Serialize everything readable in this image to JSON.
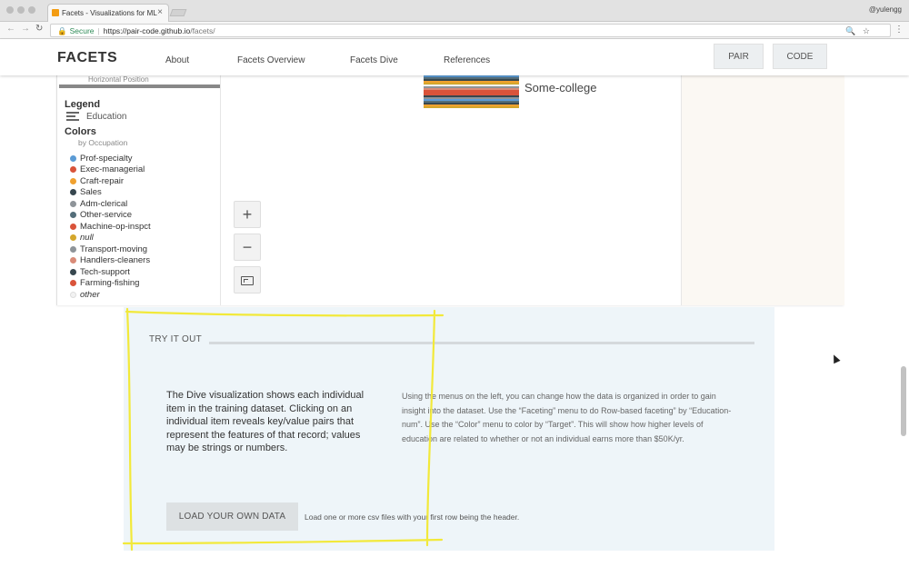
{
  "browser": {
    "tab_title": "Facets - Visualizations for ML",
    "profile": "@yulengg",
    "secure_label": "Secure",
    "url_main": "https://pair-code.github.io",
    "url_path": "/facets/"
  },
  "header": {
    "brand": "FACETS",
    "nav": [
      "About",
      "Facets Overview",
      "Facets Dive",
      "References"
    ],
    "buttons": [
      "PAIR",
      "CODE"
    ]
  },
  "dive": {
    "hidden_control_label": "Horizontal Position",
    "legend_title": "Legend",
    "legend_sub": "Education",
    "colors_title": "Colors",
    "colors_sub": "by Occupation",
    "colors": [
      {
        "label": "Prof-specialty",
        "color": "#5b9bd5",
        "italic": false
      },
      {
        "label": "Exec-managerial",
        "color": "#d9533a",
        "italic": false
      },
      {
        "label": "Craft-repair",
        "color": "#f0a12f",
        "italic": false
      },
      {
        "label": "Sales",
        "color": "#37474f",
        "italic": false
      },
      {
        "label": "Adm-clerical",
        "color": "#8e9499",
        "italic": false
      },
      {
        "label": "Other-service",
        "color": "#546e7a",
        "italic": false
      },
      {
        "label": "Machine-op-inspct",
        "color": "#d9533a",
        "italic": false
      },
      {
        "label": "null",
        "color": "#d4a72c",
        "italic": true
      },
      {
        "label": "Transport-moving",
        "color": "#8e9499",
        "italic": false
      },
      {
        "label": "Handlers-cleaners",
        "color": "#d98b78",
        "italic": false
      },
      {
        "label": "Tech-support",
        "color": "#37474f",
        "italic": false
      },
      {
        "label": "Farming-fishing",
        "color": "#d9533a",
        "italic": false
      },
      {
        "label": "other",
        "color": "#f2f2f2",
        "italic": true
      }
    ],
    "row_label": "Some-college",
    "zoom_in": "+",
    "zoom_out": "−"
  },
  "try_it_out": {
    "title": "TRY IT OUT",
    "description": "The Dive visualization shows each individual item in the training dataset. Clicking on an individual item reveals key/value pairs that represent the features of that record; values may be strings or numbers.",
    "instructions": "Using the menus on the left, you can change how the data is organized in order to gain insight into the dataset. Use the “Faceting” menu to do Row-based faceting” by “Education-num”. Use the “Color” menu to color by “Target”. This will show how higher levels of education are related to whether or not an individual earns more than $50K/yr.",
    "load_button": "LOAD YOUR OWN DATA",
    "load_hint": "Load one or more csv files with your first row being the header."
  },
  "colors": {
    "annotation": "#f2e93a",
    "section_bg": "#eef5f9"
  }
}
